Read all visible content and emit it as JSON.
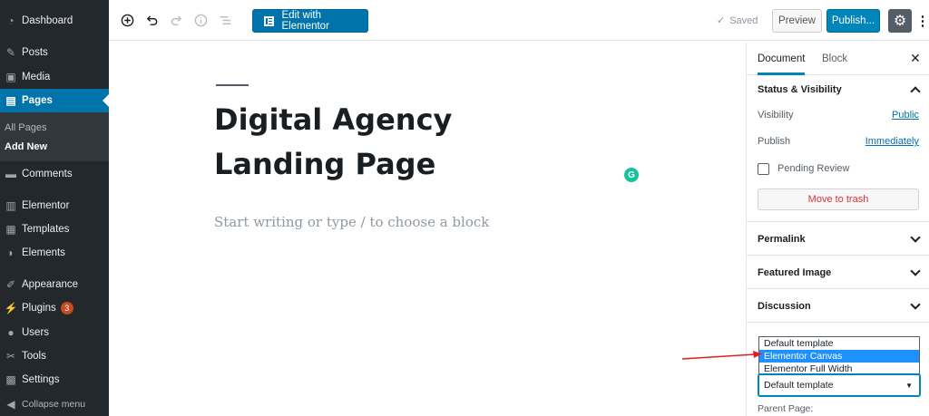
{
  "sidebar": {
    "items": [
      {
        "icon": "dashboard-icon",
        "glyph": "◔",
        "label": "Dashboard"
      },
      {
        "icon": "posts-pin-icon",
        "glyph": "✎",
        "label": "Posts"
      },
      {
        "icon": "media-icon",
        "glyph": "▣",
        "label": "Media"
      },
      {
        "icon": "pages-icon",
        "glyph": "▤",
        "label": "Pages"
      },
      {
        "icon": "comments-icon",
        "glyph": "▬",
        "label": "Comments"
      },
      {
        "icon": "elementor-icon",
        "glyph": "▥",
        "label": "Elementor"
      },
      {
        "icon": "templates-icon",
        "glyph": "▦",
        "label": "Templates"
      },
      {
        "icon": "elements-icon",
        "glyph": "◗",
        "label": "Elements"
      },
      {
        "icon": "appearance-icon",
        "glyph": "✐",
        "label": "Appearance"
      },
      {
        "icon": "plugins-icon",
        "glyph": "⚡",
        "label": "Plugins"
      },
      {
        "icon": "users-icon",
        "glyph": "●",
        "label": "Users"
      },
      {
        "icon": "tools-icon",
        "glyph": "✂",
        "label": "Tools"
      },
      {
        "icon": "settings-icon",
        "glyph": "▩",
        "label": "Settings"
      },
      {
        "icon": "collapse-icon",
        "glyph": "◀",
        "label": "Collapse menu"
      }
    ],
    "plugins_badge": "3",
    "sub_items": [
      "All Pages",
      "Add New"
    ],
    "accent_color": "#0073aa"
  },
  "toolbar": {
    "elementor_label": "Edit with Elementor",
    "saved_label": "Saved",
    "preview_label": "Preview",
    "publish_label": "Publish..."
  },
  "editor": {
    "title": "Digital Agency Landing Page",
    "placeholder": "Start writing or type / to choose a block",
    "grammarly_glyph": "G"
  },
  "panel": {
    "tabs": [
      "Document",
      "Block"
    ],
    "status_visibility": "Status & Visibility",
    "visibility_label": "Visibility",
    "visibility_value": "Public",
    "publish_label": "Publish",
    "publish_value": "Immediately",
    "pending_review": "Pending Review",
    "trash_label": "Move to trash",
    "permalink": "Permalink",
    "featured_image": "Featured Image",
    "discussion": "Discussion",
    "template_options": [
      "Default template",
      "Elementor Canvas",
      "Elementor Full Width"
    ],
    "template_highlighted": "Elementor Canvas",
    "template_selected": "Default template",
    "parent_page": "Parent Page:"
  }
}
